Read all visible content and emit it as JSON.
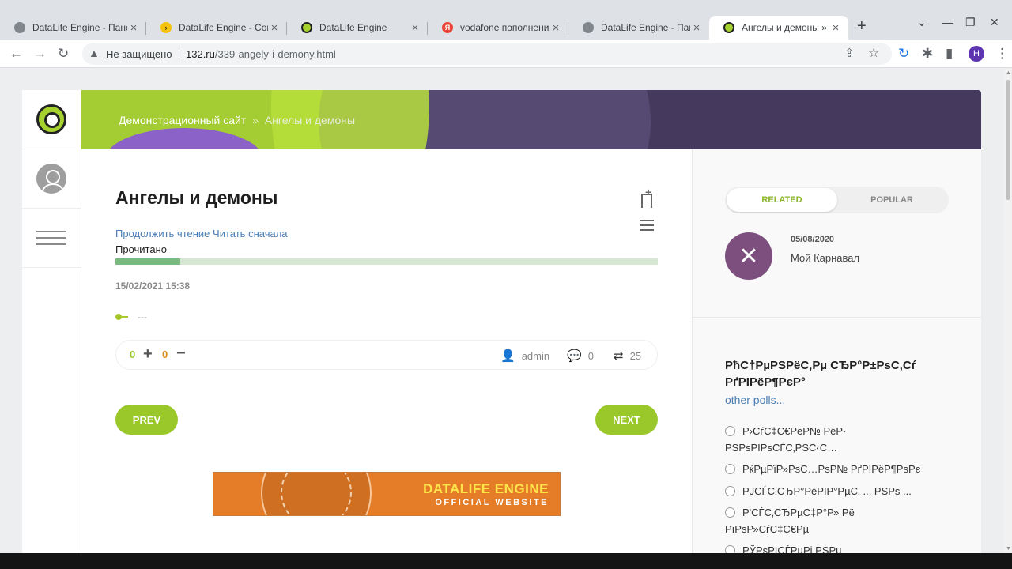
{
  "browser": {
    "tabs": [
      {
        "title": "DataLife Engine - Пане",
        "favicon": "#80868b",
        "active": false
      },
      {
        "title": "DataLife Engine - Contr",
        "favicon": "#f4c20d",
        "active": false
      },
      {
        "title": "DataLife Engine",
        "favicon": "#333333",
        "active": false
      },
      {
        "title": "vodafone пополнение",
        "favicon": "#ea4335",
        "active": false
      },
      {
        "title": "DataLife Engine - Пане",
        "favicon": "#80868b",
        "active": false
      },
      {
        "title": "Ангелы и демоны » Da",
        "favicon": "#333333",
        "active": true
      }
    ],
    "security_label": "Не защищено",
    "url_domain": "132.ru",
    "url_path": "/339-angely-i-demony.html",
    "profile_initial": "H"
  },
  "page": {
    "breadcrumb": {
      "home": "Демонстрационный сайт",
      "separator": "»",
      "current": "Ангелы и демоны"
    },
    "article": {
      "title": "Ангелы и демоны",
      "continue_reading": "Продолжить чтение",
      "read_from_start": "Читать сначала",
      "read_label": "Прочитано",
      "read_progress": 0.12,
      "date": "15/02/2021 15:38",
      "tags": "---",
      "rating_plus": "0",
      "rating_minus": "0",
      "author": "admin",
      "comments": "0",
      "views": "25",
      "prev_label": "PREV",
      "next_label": "NEXT",
      "ad_line1": "DATALIFE ENGINE",
      "ad_line2": "OFFICIAL WEBSITE"
    },
    "sidebar_right": {
      "tab_related": "RELATED",
      "tab_popular": "POPULAR",
      "related_item": {
        "date": "05/08/2020",
        "title": "Мой Карнавал"
      },
      "poll": {
        "title": "РћС†РµРЅРёС‚Рµ СЂР°Р±РѕС‚Сѓ РґРІРёР¶РєР°",
        "other_polls": "other polls...",
        "options": [
          "Р›СѓС‡С€РёР№ РёР· РЅРѕРІРѕСЃС‚РЅС‹С…",
          "РќРµРїР»РѕС…РѕР№ РґРІРёР¶РѕРє",
          "РЈСЃС‚СЂР°РёРІР°РµС‚ ... РЅРѕ ...",
          "Р'СЃС‚СЂРµС‡Р°Р» Рё РїРѕР»СѓС‡С€Рµ",
          "РЎРѕРІСЃРµРј РЅРµ"
        ]
      }
    }
  },
  "colors": {
    "accent_green": "#9ac82a",
    "link_blue": "#4a7db5",
    "banner_purple": "#46395e"
  }
}
